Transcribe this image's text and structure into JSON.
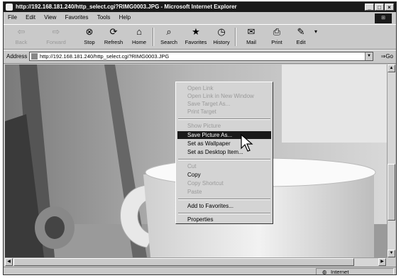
{
  "window": {
    "title": "http://192.168.181.240/http_select.cgi?RIMG0003.JPG - Microsoft Internet Explorer",
    "controls": [
      "_",
      "□",
      "×"
    ]
  },
  "menubar": [
    "File",
    "Edit",
    "View",
    "Favorites",
    "Tools",
    "Help"
  ],
  "toolbar": {
    "back": "Back",
    "forward": "Forward",
    "stop": "Stop",
    "refresh": "Refresh",
    "home": "Home",
    "search": "Search",
    "favorites": "Favorites",
    "history": "History",
    "mail": "Mail",
    "print": "Print",
    "edit": "Edit"
  },
  "address": {
    "label": "Address",
    "url": "http://192.168.181.240/http_select.cgi?RIMG0003.JPG",
    "go": "Go"
  },
  "context_menu": {
    "items": [
      {
        "label": "Open Link",
        "enabled": false
      },
      {
        "label": "Open Link in New Window",
        "enabled": false
      },
      {
        "label": "Save Target As...",
        "enabled": false
      },
      {
        "label": "Print Target",
        "enabled": false
      },
      {
        "label": "Show Picture",
        "enabled": false
      },
      {
        "label": "Save Picture As...",
        "enabled": true,
        "selected": true
      },
      {
        "label": "Set as Wallpaper",
        "enabled": true
      },
      {
        "label": "Set as Desktop Item...",
        "enabled": true
      },
      {
        "label": "Cut",
        "enabled": false
      },
      {
        "label": "Copy",
        "enabled": true
      },
      {
        "label": "Copy Shortcut",
        "enabled": false
      },
      {
        "label": "Paste",
        "enabled": false
      },
      {
        "label": "Add to Favorites...",
        "enabled": true
      },
      {
        "label": "Properties",
        "enabled": true
      }
    ]
  },
  "status": {
    "zone": "Internet"
  }
}
